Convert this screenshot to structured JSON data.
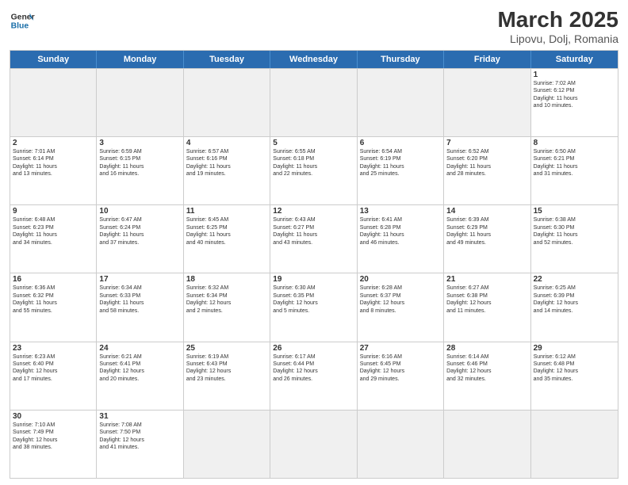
{
  "logo": {
    "text_general": "General",
    "text_blue": "Blue"
  },
  "title": "March 2025",
  "subtitle": "Lipovu, Dolj, Romania",
  "header_days": [
    "Sunday",
    "Monday",
    "Tuesday",
    "Wednesday",
    "Thursday",
    "Friday",
    "Saturday"
  ],
  "weeks": [
    [
      {
        "day": "",
        "info": "",
        "empty": true
      },
      {
        "day": "",
        "info": "",
        "empty": true
      },
      {
        "day": "",
        "info": "",
        "empty": true
      },
      {
        "day": "",
        "info": "",
        "empty": true
      },
      {
        "day": "",
        "info": "",
        "empty": true
      },
      {
        "day": "",
        "info": "",
        "empty": true
      },
      {
        "day": "1",
        "info": "Sunrise: 7:02 AM\nSunset: 6:12 PM\nDaylight: 11 hours\nand 10 minutes."
      }
    ],
    [
      {
        "day": "2",
        "info": "Sunrise: 7:01 AM\nSunset: 6:14 PM\nDaylight: 11 hours\nand 13 minutes."
      },
      {
        "day": "3",
        "info": "Sunrise: 6:59 AM\nSunset: 6:15 PM\nDaylight: 11 hours\nand 16 minutes."
      },
      {
        "day": "4",
        "info": "Sunrise: 6:57 AM\nSunset: 6:16 PM\nDaylight: 11 hours\nand 19 minutes."
      },
      {
        "day": "5",
        "info": "Sunrise: 6:55 AM\nSunset: 6:18 PM\nDaylight: 11 hours\nand 22 minutes."
      },
      {
        "day": "6",
        "info": "Sunrise: 6:54 AM\nSunset: 6:19 PM\nDaylight: 11 hours\nand 25 minutes."
      },
      {
        "day": "7",
        "info": "Sunrise: 6:52 AM\nSunset: 6:20 PM\nDaylight: 11 hours\nand 28 minutes."
      },
      {
        "day": "8",
        "info": "Sunrise: 6:50 AM\nSunset: 6:21 PM\nDaylight: 11 hours\nand 31 minutes."
      }
    ],
    [
      {
        "day": "9",
        "info": "Sunrise: 6:48 AM\nSunset: 6:23 PM\nDaylight: 11 hours\nand 34 minutes."
      },
      {
        "day": "10",
        "info": "Sunrise: 6:47 AM\nSunset: 6:24 PM\nDaylight: 11 hours\nand 37 minutes."
      },
      {
        "day": "11",
        "info": "Sunrise: 6:45 AM\nSunset: 6:25 PM\nDaylight: 11 hours\nand 40 minutes."
      },
      {
        "day": "12",
        "info": "Sunrise: 6:43 AM\nSunset: 6:27 PM\nDaylight: 11 hours\nand 43 minutes."
      },
      {
        "day": "13",
        "info": "Sunrise: 6:41 AM\nSunset: 6:28 PM\nDaylight: 11 hours\nand 46 minutes."
      },
      {
        "day": "14",
        "info": "Sunrise: 6:39 AM\nSunset: 6:29 PM\nDaylight: 11 hours\nand 49 minutes."
      },
      {
        "day": "15",
        "info": "Sunrise: 6:38 AM\nSunset: 6:30 PM\nDaylight: 11 hours\nand 52 minutes."
      }
    ],
    [
      {
        "day": "16",
        "info": "Sunrise: 6:36 AM\nSunset: 6:32 PM\nDaylight: 11 hours\nand 55 minutes."
      },
      {
        "day": "17",
        "info": "Sunrise: 6:34 AM\nSunset: 6:33 PM\nDaylight: 11 hours\nand 58 minutes."
      },
      {
        "day": "18",
        "info": "Sunrise: 6:32 AM\nSunset: 6:34 PM\nDaylight: 12 hours\nand 2 minutes."
      },
      {
        "day": "19",
        "info": "Sunrise: 6:30 AM\nSunset: 6:35 PM\nDaylight: 12 hours\nand 5 minutes."
      },
      {
        "day": "20",
        "info": "Sunrise: 6:28 AM\nSunset: 6:37 PM\nDaylight: 12 hours\nand 8 minutes."
      },
      {
        "day": "21",
        "info": "Sunrise: 6:27 AM\nSunset: 6:38 PM\nDaylight: 12 hours\nand 11 minutes."
      },
      {
        "day": "22",
        "info": "Sunrise: 6:25 AM\nSunset: 6:39 PM\nDaylight: 12 hours\nand 14 minutes."
      }
    ],
    [
      {
        "day": "23",
        "info": "Sunrise: 6:23 AM\nSunset: 6:40 PM\nDaylight: 12 hours\nand 17 minutes."
      },
      {
        "day": "24",
        "info": "Sunrise: 6:21 AM\nSunset: 6:41 PM\nDaylight: 12 hours\nand 20 minutes."
      },
      {
        "day": "25",
        "info": "Sunrise: 6:19 AM\nSunset: 6:43 PM\nDaylight: 12 hours\nand 23 minutes."
      },
      {
        "day": "26",
        "info": "Sunrise: 6:17 AM\nSunset: 6:44 PM\nDaylight: 12 hours\nand 26 minutes."
      },
      {
        "day": "27",
        "info": "Sunrise: 6:16 AM\nSunset: 6:45 PM\nDaylight: 12 hours\nand 29 minutes."
      },
      {
        "day": "28",
        "info": "Sunrise: 6:14 AM\nSunset: 6:46 PM\nDaylight: 12 hours\nand 32 minutes."
      },
      {
        "day": "29",
        "info": "Sunrise: 6:12 AM\nSunset: 6:48 PM\nDaylight: 12 hours\nand 35 minutes."
      }
    ],
    [
      {
        "day": "30",
        "info": "Sunrise: 7:10 AM\nSunset: 7:49 PM\nDaylight: 12 hours\nand 38 minutes."
      },
      {
        "day": "31",
        "info": "Sunrise: 7:08 AM\nSunset: 7:50 PM\nDaylight: 12 hours\nand 41 minutes."
      },
      {
        "day": "",
        "info": "",
        "empty": true
      },
      {
        "day": "",
        "info": "",
        "empty": true
      },
      {
        "day": "",
        "info": "",
        "empty": true
      },
      {
        "day": "",
        "info": "",
        "empty": true
      },
      {
        "day": "",
        "info": "",
        "empty": true
      }
    ]
  ]
}
